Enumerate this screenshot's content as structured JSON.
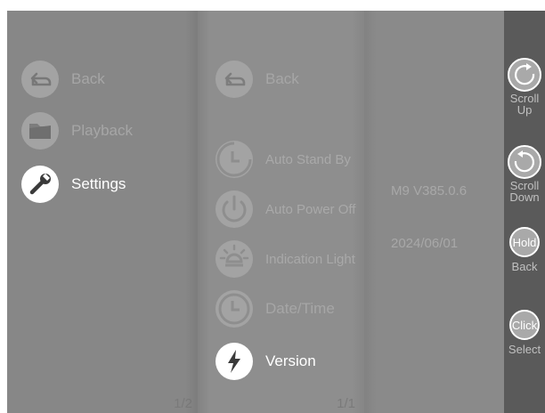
{
  "menu_main": {
    "items": [
      {
        "label": "Back",
        "icon": "back-arrow-icon"
      },
      {
        "label": "Playback",
        "icon": "folder-icon"
      },
      {
        "label": "Settings",
        "icon": "wrench-icon",
        "selected": true
      }
    ],
    "page": "1/2"
  },
  "menu_settings": {
    "items": [
      {
        "label": "Back",
        "icon": "back-arrow-icon"
      },
      {
        "label": "Auto Stand By",
        "icon": "timer-icon"
      },
      {
        "label": "Auto Power Off",
        "icon": "power-icon"
      },
      {
        "label": "Indication Light",
        "icon": "light-icon"
      },
      {
        "label": "Date/Time",
        "icon": "clock-icon"
      },
      {
        "label": "Version",
        "icon": "lightning-icon",
        "selected": true
      }
    ],
    "page": "1/1"
  },
  "info": {
    "version": "M9 V385.0.6",
    "date": "2024/06/01"
  },
  "controls": {
    "scroll_up": {
      "label": "Scroll",
      "sub": "Up"
    },
    "scroll_down": {
      "label": "Scroll",
      "sub": "Down"
    },
    "hold": {
      "badge": "Hold",
      "sub": "Back"
    },
    "click": {
      "badge": "Click",
      "sub": "Select"
    }
  },
  "colors": {
    "selected_text": "#ffffff",
    "dim_text": "#a6a6a6",
    "sidebar": "#5a5a5a"
  }
}
